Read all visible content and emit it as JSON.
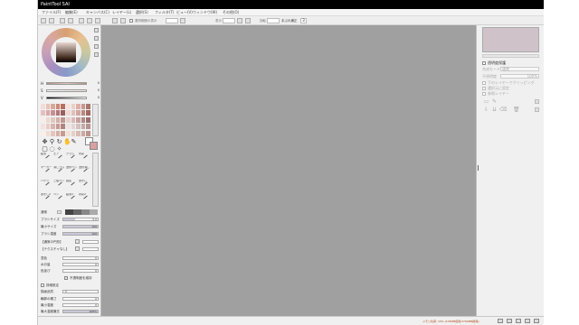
{
  "window": {
    "title": "PaintTool SAI"
  },
  "menu": [
    "ファイル(F)",
    "編集(E)",
    "キャンバス(C)",
    "レイヤー(L)",
    "選択(S)",
    "フィルタ(T)",
    "ビュー(V)",
    "ウィンドウ(W)",
    "その他(O)"
  ],
  "toolbar": {
    "selection_toggle": "選択範囲の表示",
    "zoom_label": "表示",
    "rotation_label": "回転",
    "stabilizer_label": "手ぶれ補正",
    "stabilizer_value": "3"
  },
  "color_sliders": [
    {
      "label": "H",
      "value": "0"
    },
    {
      "label": "S",
      "value": "0"
    },
    {
      "label": "V",
      "value": "0"
    }
  ],
  "swatches": [
    "#f2ddd8",
    "#e8c2b8",
    "#d9a898",
    "#c88a78",
    "#b86e60",
    "#f4e4e0",
    "#ecd0c8",
    "#dcb0a8",
    "#c89890",
    "#a87870",
    "#e6c0c0",
    "#d8a8a8",
    "#c89090",
    "#b07878",
    "#986060",
    "#f0d8d0",
    "#e0c0b8",
    "#d0a8a0",
    "#b88880",
    "#a06860",
    "#f8ece8",
    "#ecd8d0",
    "#e0c8c0",
    "#d0b0a8",
    "#c09890",
    "#e8d0d0",
    "#dcb8b8",
    "#c8a0a0",
    "#b08888",
    "#987070",
    "#f4e0dc",
    "#e8ccc4",
    "#d8b4ac",
    "#c49c94",
    "#b0847c",
    "#ede4e4",
    "#e4d4d4",
    "#d4c0c0",
    "#c4aaaa",
    "#b49494",
    "#fbefe9",
    "#f1ddd3",
    "#e3c7bd",
    "#d5b1a7",
    "#c79b91",
    "#f0e0d8",
    "#e6d0c8",
    "#d8bcb4",
    "#caa8a0",
    "#bc948c"
  ],
  "brushes": [
    "鉛筆",
    "エア",
    "ブラシ",
    "水彩",
    "マーカー",
    "消しゴム",
    "選択ペン",
    "選択消し",
    "バケツ",
    "二値ペン",
    "指先",
    "ぼかし",
    "ぼかし2",
    "ペン",
    "鉛筆2",
    "水彩2"
  ],
  "brush_settings": {
    "mode": "通常",
    "blend_label": "ブラシサイズ",
    "blend_value": "5.0",
    "size_label": "最小サイズ",
    "size_value": "100",
    "density_label": "ブラシ濃度",
    "density_value": "100",
    "shape_label": "【通常の円形】",
    "texture_label": "【テクスチャなし】",
    "blend_amount_label": "混色",
    "water_label": "水分量",
    "persistence_label": "色延び",
    "keep_opacity_label": "不透明度を維持",
    "detail_header": "詳細設定",
    "quality_label": "描画品質",
    "quality_value": "5",
    "edge_label": "輪郭の硬さ",
    "edge_value": "0",
    "min_density_label": "最小濃度",
    "min_density_value": "0",
    "max_density_label": "最大濃度筆圧",
    "max_density_value": "100%",
    "pressure_label": "筆圧 硬⇔軟",
    "pressure_value": "100"
  },
  "right_panel": {
    "preserve_opacity": "透明度保護",
    "mode_label": "合成モード",
    "mode_value": "通常",
    "opacity_label": "不透明度",
    "opacity_value": "100%",
    "clipping": "下のレイヤーでクリッピング",
    "selection_source": "選択元に設定",
    "reference": "参照レイヤー"
  },
  "status": {
    "memory": "メモリ負荷: 15% (105MB使用/3760MB確保)"
  }
}
